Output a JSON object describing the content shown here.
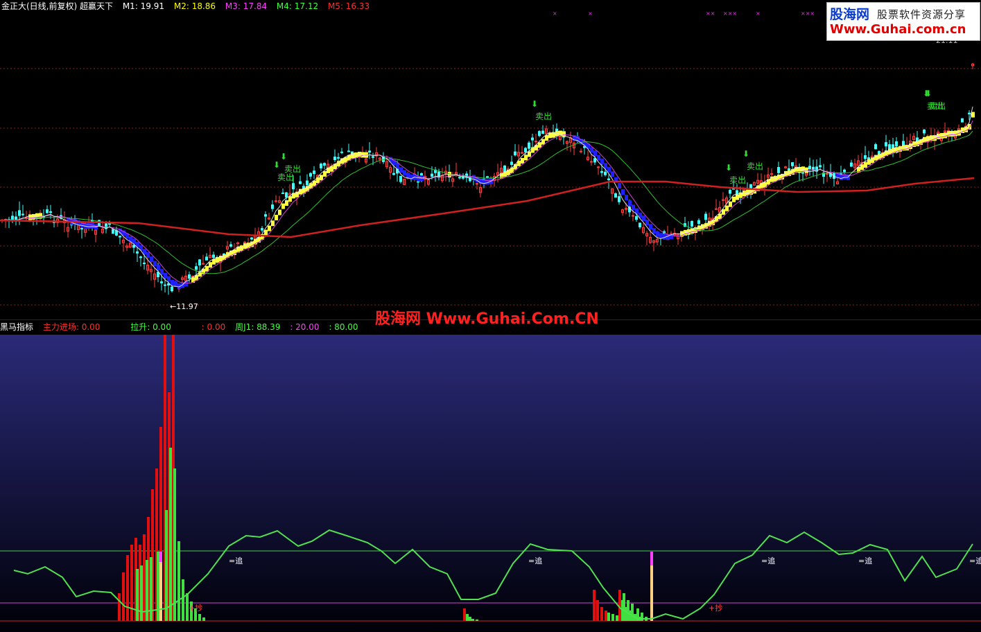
{
  "top_header": {
    "name": "金正大(日线,前复权) 超赢天下",
    "ma": [
      {
        "label": "M1: 19.91",
        "color": "#ffffff"
      },
      {
        "label": "M2: 18.86",
        "color": "#ffff00"
      },
      {
        "label": "M3: 17.84",
        "color": "#ff40ff"
      },
      {
        "label": "M4: 17.12",
        "color": "#40ff40"
      },
      {
        "label": "M5: 16.33",
        "color": "#ff3030"
      }
    ]
  },
  "price_chart": {
    "low_label": "11.97",
    "high_label": "21.11",
    "sell_label": "卖出",
    "sell_count": 7
  },
  "watermark": "股海网 Www.Guhai.Com.CN",
  "logo": {
    "line1": "股海网",
    "line2": "股票软件资源分享",
    "line3": "Www.Guhai.com.cn"
  },
  "lower_header": {
    "title": "黑马指标",
    "items": [
      {
        "label": "主力进场: 0.00",
        "color": "#ff3030"
      },
      {
        "label": "拉升: 0.00",
        "color": "#40ff40"
      },
      {
        "label": ": 0.00",
        "color": "#ff3030"
      },
      {
        "label": "周J1: 88.39",
        "color": "#40ff40"
      },
      {
        "label": ": 20.00",
        "color": "#ff40ff"
      },
      {
        "label": ": 80.00",
        "color": "#40ff40"
      }
    ]
  },
  "indicator": {
    "chase_label": "=追",
    "bottom_label": "+抄",
    "levels": [
      20,
      80
    ]
  },
  "colors": {
    "up": "#ff4040",
    "down": "#40ffff",
    "ma_red": "#d02020",
    "ma_green": "#30c030",
    "yellow": "#ffff40",
    "blue": "#2020ff",
    "line_green": "#50e050"
  }
}
